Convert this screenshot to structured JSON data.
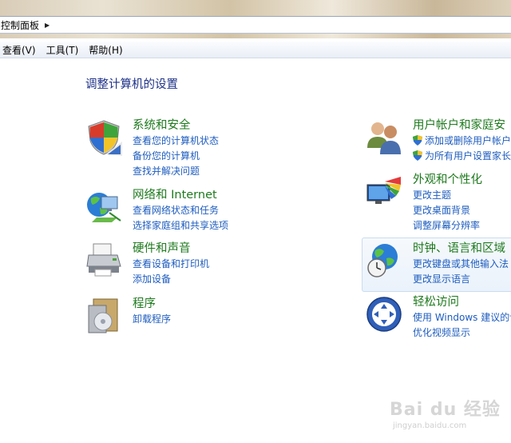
{
  "address": {
    "crumb": "控制面板"
  },
  "menu": [
    {
      "label": "查看(V)"
    },
    {
      "label": "工具(T)"
    },
    {
      "label": "帮助(H)"
    }
  ],
  "page_title": "调整计算机的设置",
  "categories": {
    "system": {
      "title": "系统和安全",
      "links": [
        "查看您的计算机状态",
        "备份您的计算机",
        "查找并解决问题"
      ]
    },
    "network": {
      "title": "网络和 Internet",
      "links": [
        "查看网络状态和任务",
        "选择家庭组和共享选项"
      ]
    },
    "hardware": {
      "title": "硬件和声音",
      "links": [
        "查看设备和打印机",
        "添加设备"
      ]
    },
    "programs": {
      "title": "程序",
      "links": [
        "卸载程序"
      ]
    },
    "users": {
      "title": "用户帐户和家庭安",
      "links": [
        "添加或删除用户帐户",
        "为所有用户设置家长"
      ]
    },
    "appearance": {
      "title": "外观和个性化",
      "links": [
        "更改主题",
        "更改桌面背景",
        "调整屏幕分辨率"
      ]
    },
    "clock": {
      "title": "时钟、语言和区域",
      "links": [
        "更改键盘或其他输入法",
        "更改显示语言"
      ]
    },
    "access": {
      "title": "轻松访问",
      "links": [
        "使用 Windows 建议的设",
        "优化视频显示"
      ]
    }
  },
  "watermark": {
    "main": "Bai du 经验",
    "sub": "jingyan.baidu.com"
  },
  "icons": {
    "system": "shield-icon",
    "network": "globe-network-icon",
    "hardware": "printer-icon",
    "programs": "program-box-icon",
    "users": "users-icon",
    "appearance": "monitor-palette-icon",
    "clock": "globe-clock-icon",
    "access": "ease-of-access-icon"
  }
}
